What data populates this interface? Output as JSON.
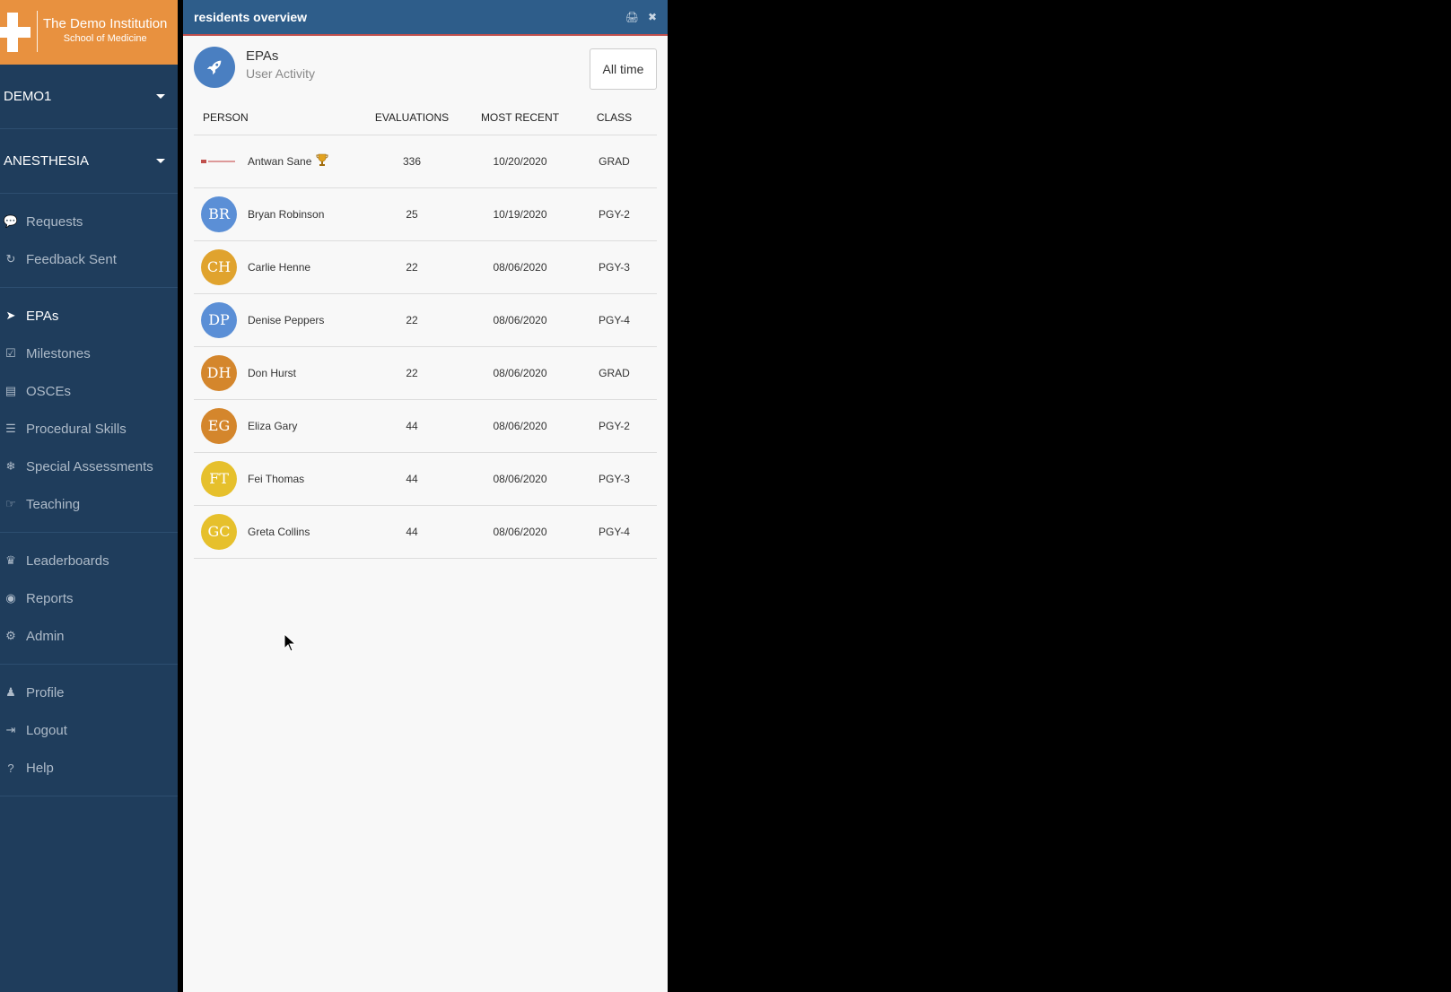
{
  "brand": {
    "line1": "The Demo Institution",
    "line2": "School of Medicine",
    "color": "#e8913f"
  },
  "sidebar": {
    "dropdowns": [
      {
        "label": "DEMO1"
      },
      {
        "label": "ANESTHESIA"
      }
    ],
    "groups": [
      [
        {
          "label": "Requests",
          "icon": "comments-icon"
        },
        {
          "label": "Feedback Sent",
          "icon": "history-icon"
        }
      ],
      [
        {
          "label": "EPAs",
          "icon": "rocket-icon",
          "active": true
        },
        {
          "label": "Milestones",
          "icon": "check-square-icon"
        },
        {
          "label": "OSCEs",
          "icon": "map-icon"
        },
        {
          "label": "Procedural Skills",
          "icon": "list-icon"
        },
        {
          "label": "Special Assessments",
          "icon": "snowflake-icon"
        },
        {
          "label": "Teaching",
          "icon": "hand-pointer-icon"
        }
      ],
      [
        {
          "label": "Leaderboards",
          "icon": "trophy-icon"
        },
        {
          "label": "Reports",
          "icon": "palette-icon"
        },
        {
          "label": "Admin",
          "icon": "gear-icon"
        }
      ],
      [
        {
          "label": "Profile",
          "icon": "user-icon"
        },
        {
          "label": "Logout",
          "icon": "sign-out-icon"
        },
        {
          "label": "Help",
          "icon": "question-circle-icon"
        }
      ]
    ]
  },
  "panel": {
    "title": "residents overview",
    "section_title": "EPAs",
    "section_subtitle": "User Activity",
    "time_filter": "All time",
    "columns": {
      "person": "PERSON",
      "evaluations": "EVALUATIONS",
      "most_recent": "MOST RECENT",
      "class": "CLASS"
    },
    "rows": [
      {
        "initials": "",
        "name": "Antwan Sane",
        "evaluations": "336",
        "most_recent": "10/20/2020",
        "class": "GRAD",
        "color": "",
        "logo": true,
        "trophy": true
      },
      {
        "initials": "BR",
        "name": "Bryan Robinson",
        "evaluations": "25",
        "most_recent": "10/19/2020",
        "class": "PGY-2",
        "color": "#5b8fd6"
      },
      {
        "initials": "CH",
        "name": "Carlie Henne",
        "evaluations": "22",
        "most_recent": "08/06/2020",
        "class": "PGY-3",
        "color": "#e0a32e"
      },
      {
        "initials": "DP",
        "name": "Denise Peppers",
        "evaluations": "22",
        "most_recent": "08/06/2020",
        "class": "PGY-4",
        "color": "#5b8fd6"
      },
      {
        "initials": "DH",
        "name": "Don Hurst",
        "evaluations": "22",
        "most_recent": "08/06/2020",
        "class": "GRAD",
        "color": "#d4862c"
      },
      {
        "initials": "EG",
        "name": "Eliza Gary",
        "evaluations": "44",
        "most_recent": "08/06/2020",
        "class": "PGY-2",
        "color": "#d4862c"
      },
      {
        "initials": "FT",
        "name": "Fei Thomas",
        "evaluations": "44",
        "most_recent": "08/06/2020",
        "class": "PGY-3",
        "color": "#e6c02c"
      },
      {
        "initials": "GC",
        "name": "Greta Collins",
        "evaluations": "44",
        "most_recent": "08/06/2020",
        "class": "PGY-4",
        "color": "#e6c02c"
      }
    ]
  }
}
